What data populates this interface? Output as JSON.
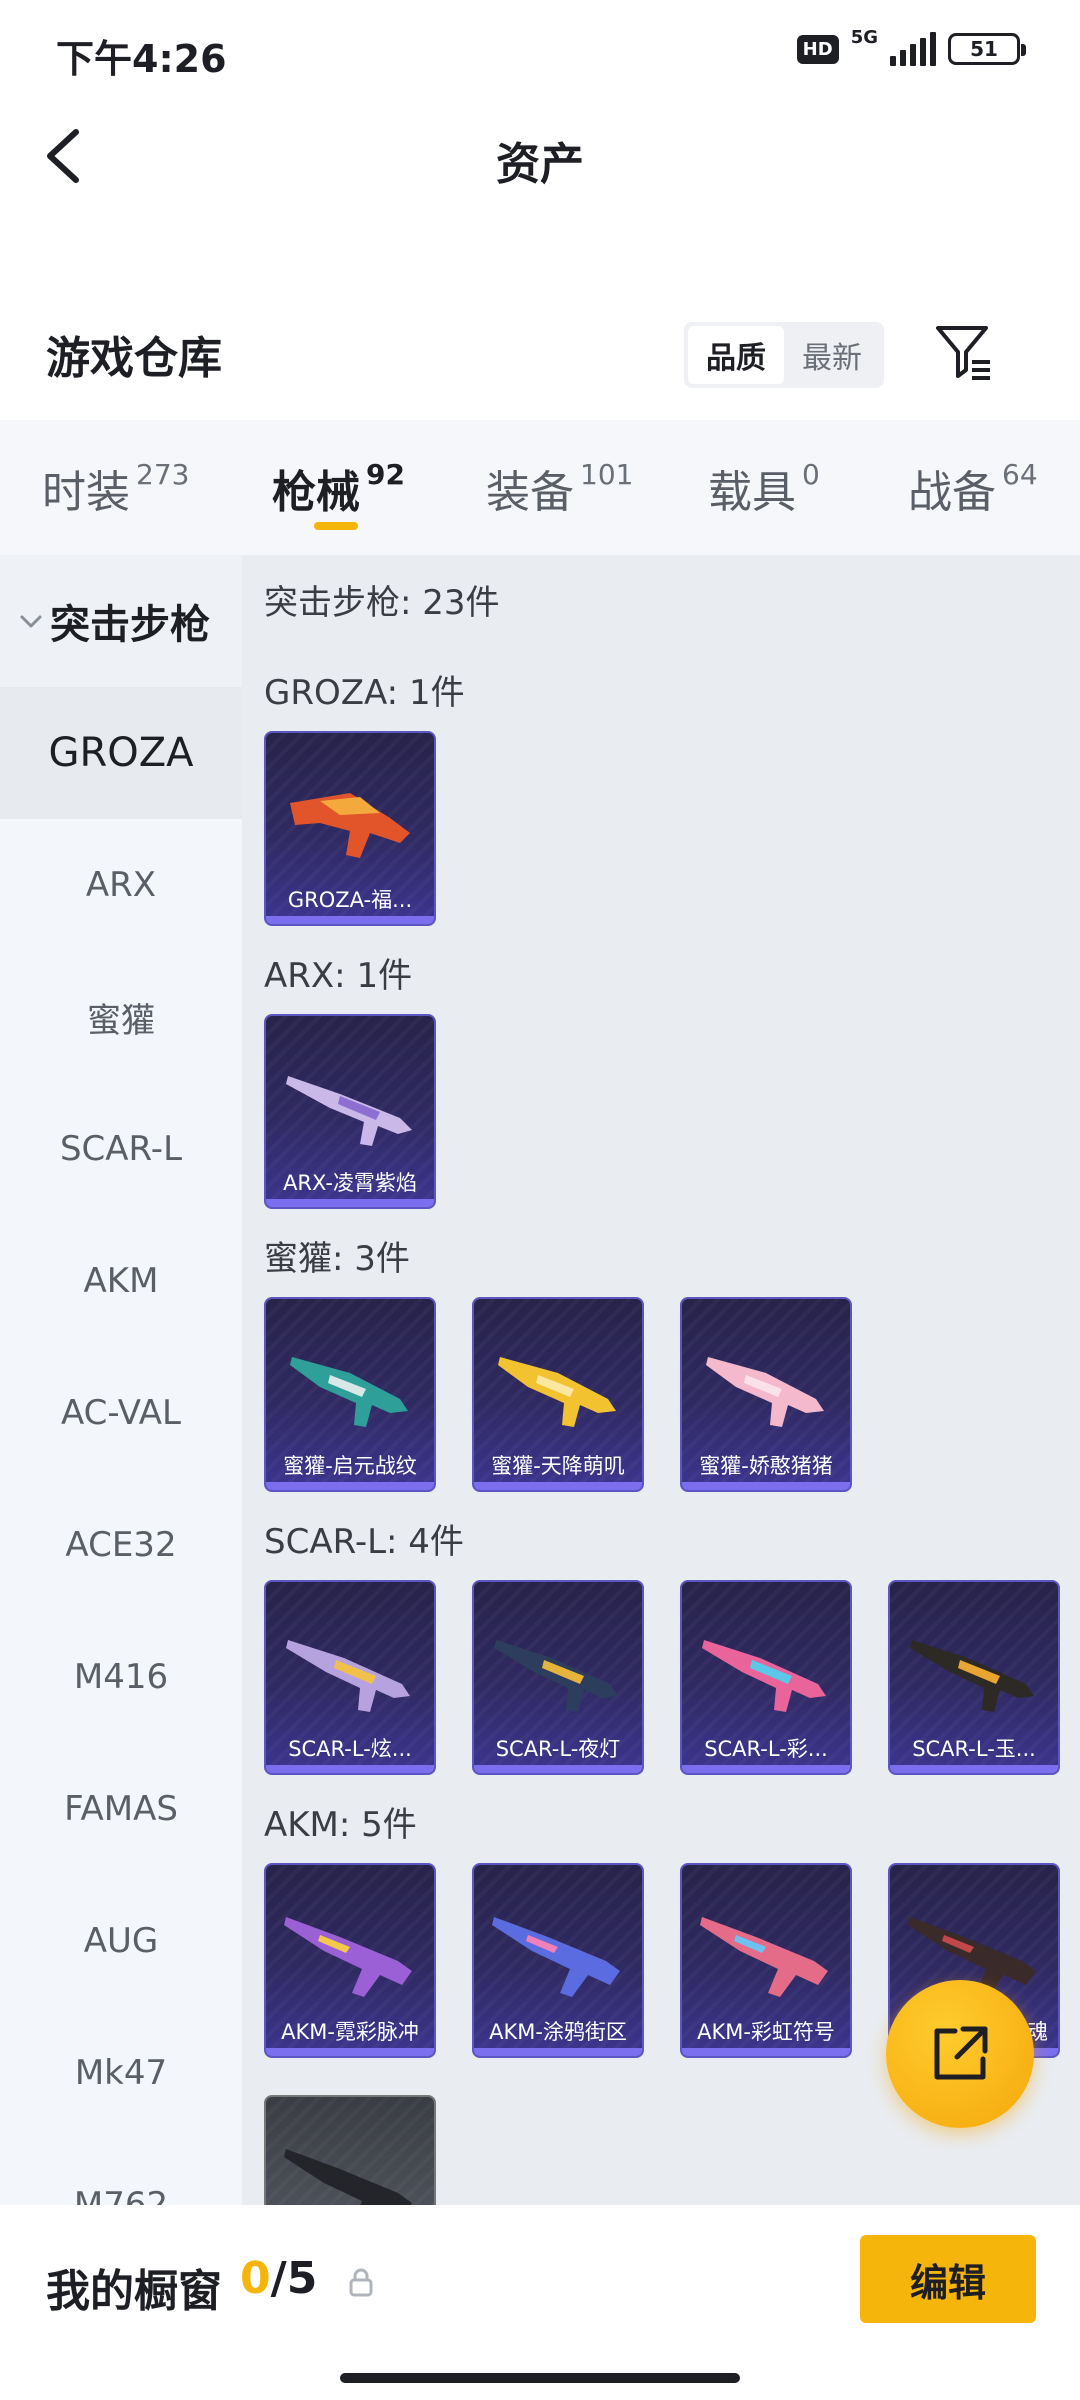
{
  "status_bar": {
    "time": "下午4:26",
    "hd": "HD",
    "network": "5G",
    "battery": "51"
  },
  "header": {
    "title": "资产",
    "back_icon": "back-chevron-icon"
  },
  "warehouse": {
    "title": "游戏仓库",
    "sort_options": [
      "品质",
      "最新"
    ],
    "sort_selected": "品质",
    "filter_icon": "filter-icon"
  },
  "tabs": [
    {
      "label": "时装",
      "count": "273"
    },
    {
      "label": "枪械",
      "count": "92",
      "active": true
    },
    {
      "label": "装备",
      "count": "101"
    },
    {
      "label": "载具",
      "count": "0"
    },
    {
      "label": "战备",
      "count": "64"
    }
  ],
  "sidebar": {
    "category": "突击步枪",
    "items": [
      "GROZA",
      "ARX",
      "蜜獾",
      "SCAR-L",
      "AKM",
      "AC-VAL",
      "ACE32",
      "M416",
      "FAMAS",
      "AUG",
      "Mk47",
      "M762"
    ],
    "active": "GROZA"
  },
  "content": {
    "summary": "突击步枪: 23件",
    "sections": [
      {
        "title": "GROZA: 1件",
        "items": [
          "GROZA-福..."
        ]
      },
      {
        "title": "ARX: 1件",
        "items": [
          "ARX-凌霄紫焰"
        ]
      },
      {
        "title": "蜜獾: 3件",
        "items": [
          "蜜獾-启元战纹",
          "蜜獾-天降萌叽",
          "蜜獾-娇憨猪猪"
        ]
      },
      {
        "title": "SCAR-L: 4件",
        "items": [
          "SCAR-L-炫...",
          "SCAR-L-夜灯",
          "SCAR-L-彩...",
          "SCAR-L-玉..."
        ]
      },
      {
        "title": "AKM: 5件",
        "items": [
          "AKM-霓彩脉冲",
          "AKM-涂鸦街区",
          "AKM-彩虹符号",
          "魂"
        ]
      }
    ]
  },
  "fab": {
    "icon": "share-external-icon"
  },
  "bottom_bar": {
    "label": "我的橱窗",
    "count_current": "0",
    "count_separator": "/",
    "count_total": "5",
    "edit_label": "编辑"
  },
  "colors": {
    "accent": "#f5b50a",
    "card_bg": "#302a63",
    "card_border": "#5d56c2"
  }
}
